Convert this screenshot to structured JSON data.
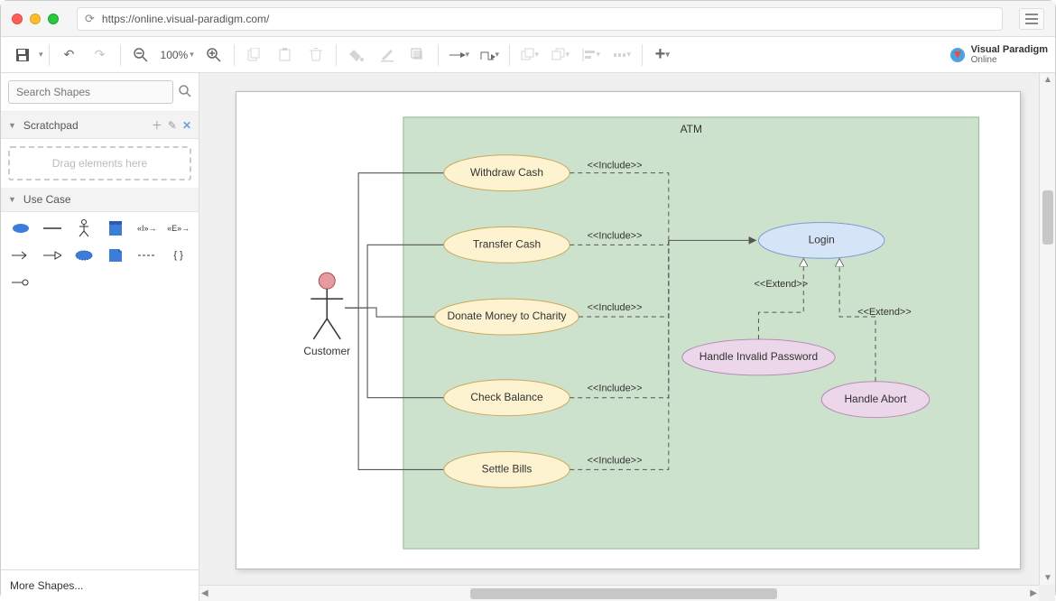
{
  "browser": {
    "url": "https://online.visual-paradigm.com/"
  },
  "brand": {
    "line1": "Visual Paradigm",
    "line2": "Online"
  },
  "toolbar": {
    "zoom": "100%"
  },
  "sidebar": {
    "search_placeholder": "Search Shapes",
    "scratchpad_title": "Scratchpad",
    "dropzone_text": "Drag elements here",
    "usecase_title": "Use Case",
    "more_shapes": "More Shapes..."
  },
  "diagram": {
    "system_name": "ATM",
    "actor_name": "Customer",
    "usecases": {
      "withdraw": "Withdraw Cash",
      "transfer": "Transfer Cash",
      "donate": "Donate Money to Charity",
      "balance": "Check Balance",
      "bills": "Settle Bills",
      "login": "Login",
      "invalid": "Handle Invalid Password",
      "abort": "Handle Abort"
    },
    "relations": {
      "include": "<<Include>>",
      "extend": "<<Extend>>"
    }
  }
}
